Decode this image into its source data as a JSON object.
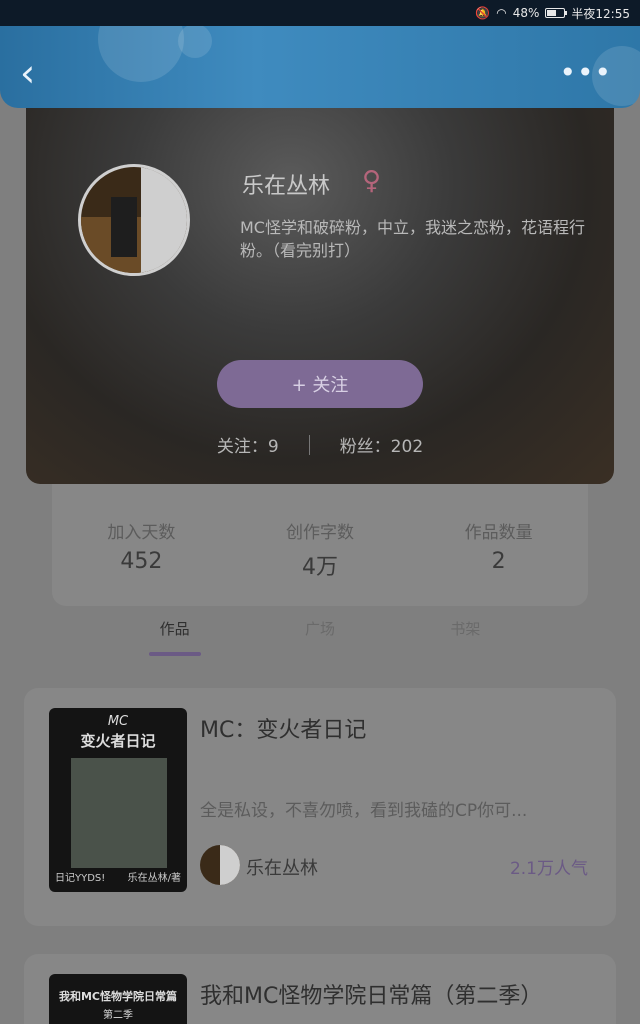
{
  "status_bar": {
    "battery": "48%",
    "time": "半夜12:55"
  },
  "profile": {
    "name": "乐在丛林",
    "gender_symbol": "♀",
    "bio": "MC怪学和破碎粉，中立，我迷之恋粉，花语程行粉。（看完别打）",
    "follow_button": "+  关注",
    "following_label": "关注：9",
    "fans_label": "粉丝：202"
  },
  "stats": [
    {
      "label": "加入天数",
      "value": "452"
    },
    {
      "label": "创作字数",
      "value": "4万"
    },
    {
      "label": "作品数量",
      "value": "2"
    }
  ],
  "tabs": [
    "作品",
    "广场",
    "书架"
  ],
  "works": [
    {
      "title": "MC：变火者日记",
      "desc": "全是私设，不喜勿喷，看到我磕的CP你可...",
      "author": "乐在丛林",
      "popularity": "2.1万人气",
      "cover_line1": "MC",
      "cover_line2": "变火者日记",
      "cover_line3": "日记YYDS!",
      "cover_line4": "乐在丛林/著"
    },
    {
      "title": "我和MC怪物学院日常篇（第二季）",
      "cover_line1": "我和MC怪物学院日常篇",
      "cover_line2": "第二季"
    }
  ]
}
